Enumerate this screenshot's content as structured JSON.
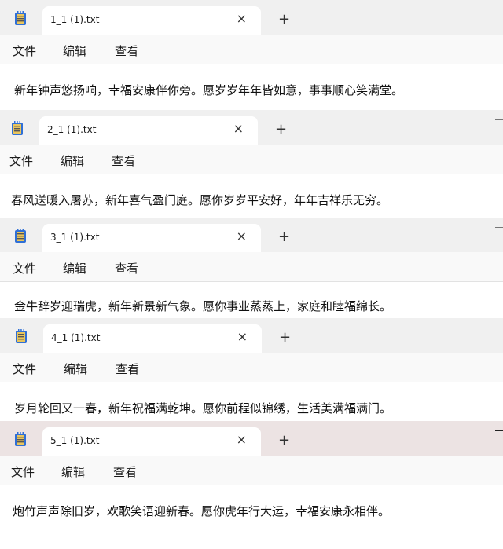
{
  "menu": {
    "file": "文件",
    "edit": "编辑",
    "view": "查看"
  },
  "icons": {
    "notepad": "notepad-icon",
    "close": "close-icon",
    "new_tab": "plus-icon"
  },
  "colors": {
    "titlebar": "#f0f0f0",
    "active_titlebar": "#ece3e3",
    "menubar": "#f9f9f9",
    "icon_blue": "#2f6fd6",
    "icon_yellow": "#e9c55c"
  },
  "windows": [
    {
      "tab_title": "1_1 (1).txt",
      "close_glyph": "×",
      "new_tab_glyph": "+",
      "content": "新年钟声悠扬响，幸福安康伴你旁。愿岁岁年年皆如意，事事顺心笑满堂。"
    },
    {
      "tab_title": "2_1 (1).txt",
      "close_glyph": "×",
      "new_tab_glyph": "+",
      "content": "春风送暖入屠苏，新年喜气盈门庭。愿你岁岁平安好，年年吉祥乐无穷。"
    },
    {
      "tab_title": "3_1 (1).txt",
      "close_glyph": "×",
      "new_tab_glyph": "+",
      "content": "金牛辞岁迎瑞虎，新年新景新气象。愿你事业蒸蒸上，家庭和睦福绵长。"
    },
    {
      "tab_title": "4_1 (1).txt",
      "close_glyph": "×",
      "new_tab_glyph": "+",
      "content": "岁月轮回又一春，新年祝福满乾坤。愿你前程似锦绣，生活美满福满门。"
    },
    {
      "tab_title": "5_1 (1).txt",
      "close_glyph": "×",
      "new_tab_glyph": "+",
      "content": "炮竹声声除旧岁，欢歌笑语迎新春。愿你虎年行大运，幸福安康永相伴。"
    }
  ]
}
